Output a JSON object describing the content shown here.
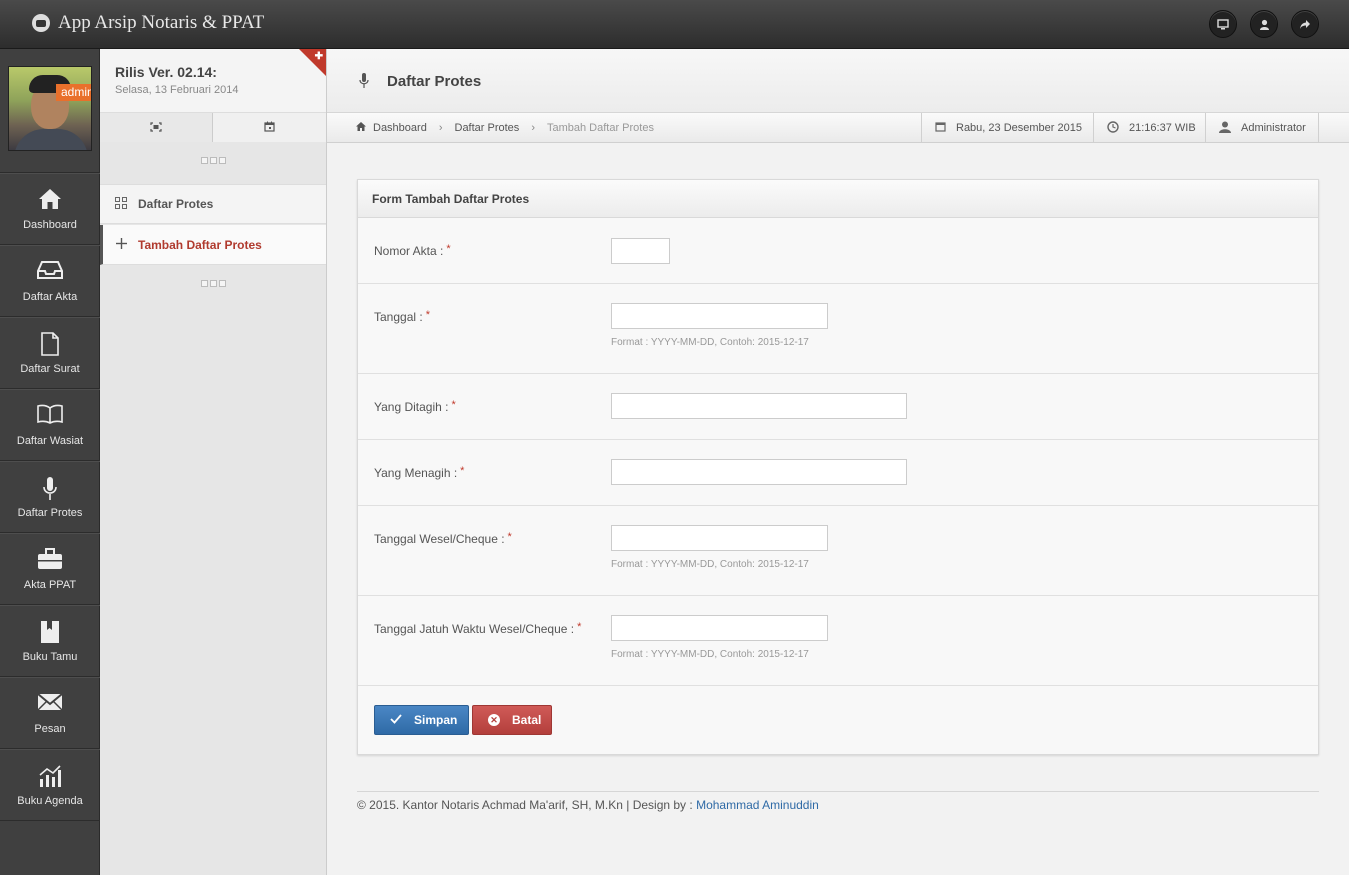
{
  "app": {
    "title": "App Arsip Notaris & PPAT"
  },
  "topbar": {
    "icons": [
      "monitor-icon",
      "user-icon",
      "share-icon"
    ]
  },
  "user": {
    "role_badge": "admin"
  },
  "leftnav": {
    "items": [
      {
        "label": "Dashboard",
        "icon": "home-icon"
      },
      {
        "label": "Daftar Akta",
        "icon": "inbox-icon"
      },
      {
        "label": "Daftar Surat",
        "icon": "file-icon"
      },
      {
        "label": "Daftar Wasiat",
        "icon": "book-open-icon"
      },
      {
        "label": "Daftar Protes",
        "icon": "microphone-icon"
      },
      {
        "label": "Akta PPAT",
        "icon": "briefcase-icon"
      },
      {
        "label": "Buku Tamu",
        "icon": "book-icon"
      },
      {
        "label": "Pesan",
        "icon": "envelope-icon"
      },
      {
        "label": "Buku Agenda",
        "icon": "chart-icon"
      }
    ]
  },
  "sidebar": {
    "release_title": "Rilis Ver. 02.14:",
    "release_date": "Selasa, 13 Februari 2014",
    "items": [
      {
        "label": "Daftar Protes",
        "icon": "grid-icon"
      },
      {
        "label": "Tambah Daftar Protes",
        "icon": "plus-icon"
      }
    ]
  },
  "header": {
    "title": "Daftar Protes"
  },
  "breadcrumb": {
    "home": "Dashboard",
    "level1": "Daftar Protes",
    "current": "Tambah Daftar Protes"
  },
  "status": {
    "date": "Rabu, 23 Desember 2015",
    "time": "21:16:37 WIB",
    "user": "Administrator"
  },
  "form": {
    "title": "Form Tambah Daftar Protes",
    "required_mark": "*",
    "fields": [
      {
        "label": "Nomor Akta :",
        "value": "",
        "hint": ""
      },
      {
        "label": "Tanggal :",
        "value": "",
        "hint": "Format : YYYY-MM-DD, Contoh: 2015-12-17"
      },
      {
        "label": "Yang Ditagih :",
        "value": "",
        "hint": ""
      },
      {
        "label": "Yang Menagih :",
        "value": "",
        "hint": ""
      },
      {
        "label": "Tanggal Wesel/Cheque :",
        "value": "",
        "hint": "Format : YYYY-MM-DD, Contoh: 2015-12-17"
      },
      {
        "label": "Tanggal Jatuh Waktu Wesel/Cheque :",
        "value": "",
        "hint": "Format : YYYY-MM-DD, Contoh: 2015-12-17"
      }
    ],
    "save_label": "Simpan",
    "cancel_label": "Batal"
  },
  "footer": {
    "text": "© 2015. Kantor Notaris Achmad Ma'arif, SH, M.Kn | Design by :",
    "author": "Mohammad Aminuddin"
  }
}
